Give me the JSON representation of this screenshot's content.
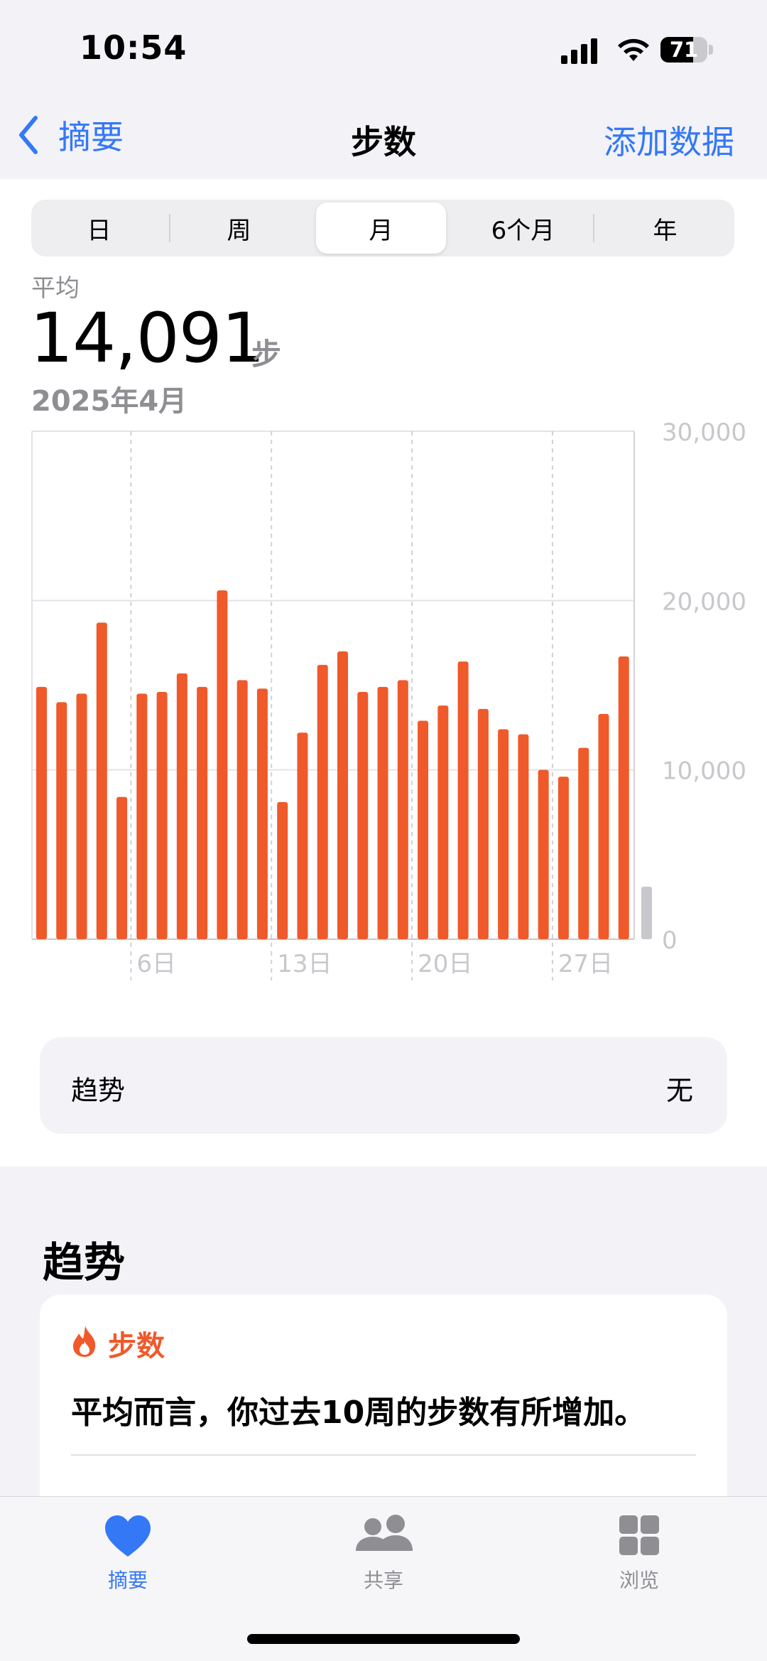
{
  "status_bar": {
    "time": "10:54",
    "battery": "71"
  },
  "nav": {
    "back_label": "摘要",
    "title": "步数",
    "action_label": "添加数据"
  },
  "segments": [
    "日",
    "周",
    "月",
    "6个月",
    "年"
  ],
  "selected_segment": "月",
  "summary": {
    "label": "平均",
    "value": "14,091",
    "unit": "步",
    "date_range": "2025年4月"
  },
  "chart_data": {
    "type": "bar",
    "x_tick_labels": [
      "6日",
      "13日",
      "20日",
      "27日"
    ],
    "y_tick_labels": [
      "30,000",
      "20,000",
      "10,000",
      "0"
    ],
    "ylim": [
      0,
      30000
    ],
    "x": [
      1,
      2,
      3,
      4,
      5,
      6,
      7,
      8,
      9,
      10,
      11,
      12,
      13,
      14,
      15,
      16,
      17,
      18,
      19,
      20,
      21,
      22,
      23,
      24,
      25,
      26,
      27,
      28,
      29,
      30
    ],
    "values": [
      14900,
      14000,
      14500,
      18700,
      8400,
      14500,
      14600,
      15700,
      14900,
      20600,
      15300,
      14800,
      8100,
      12200,
      16200,
      17000,
      14600,
      14900,
      15300,
      12900,
      13800,
      16400,
      13600,
      12400,
      12100,
      10000,
      9600,
      11300,
      13300,
      16700
    ],
    "pending_value": 3100,
    "colors": {
      "bar": "#f0592a",
      "pending": "#c7c7cc",
      "grid": "#d1d1d6",
      "tick": "#c7c7cc"
    }
  },
  "trend_row": {
    "label": "趋势",
    "value": "无"
  },
  "trends_section": {
    "heading": "趋势",
    "card_title": "步数",
    "card_icon": "flame-icon",
    "card_text": "平均而言，你过去10周的步数有所增加。"
  },
  "tabs": [
    {
      "label": "摘要",
      "icon": "heart-icon",
      "active": true
    },
    {
      "label": "共享",
      "icon": "people-icon",
      "active": false
    },
    {
      "label": "浏览",
      "icon": "grid-icon",
      "active": false
    }
  ],
  "colors": {
    "accent": "#3478f6",
    "steps": "#f0592a",
    "inactive": "#8e8e93"
  }
}
